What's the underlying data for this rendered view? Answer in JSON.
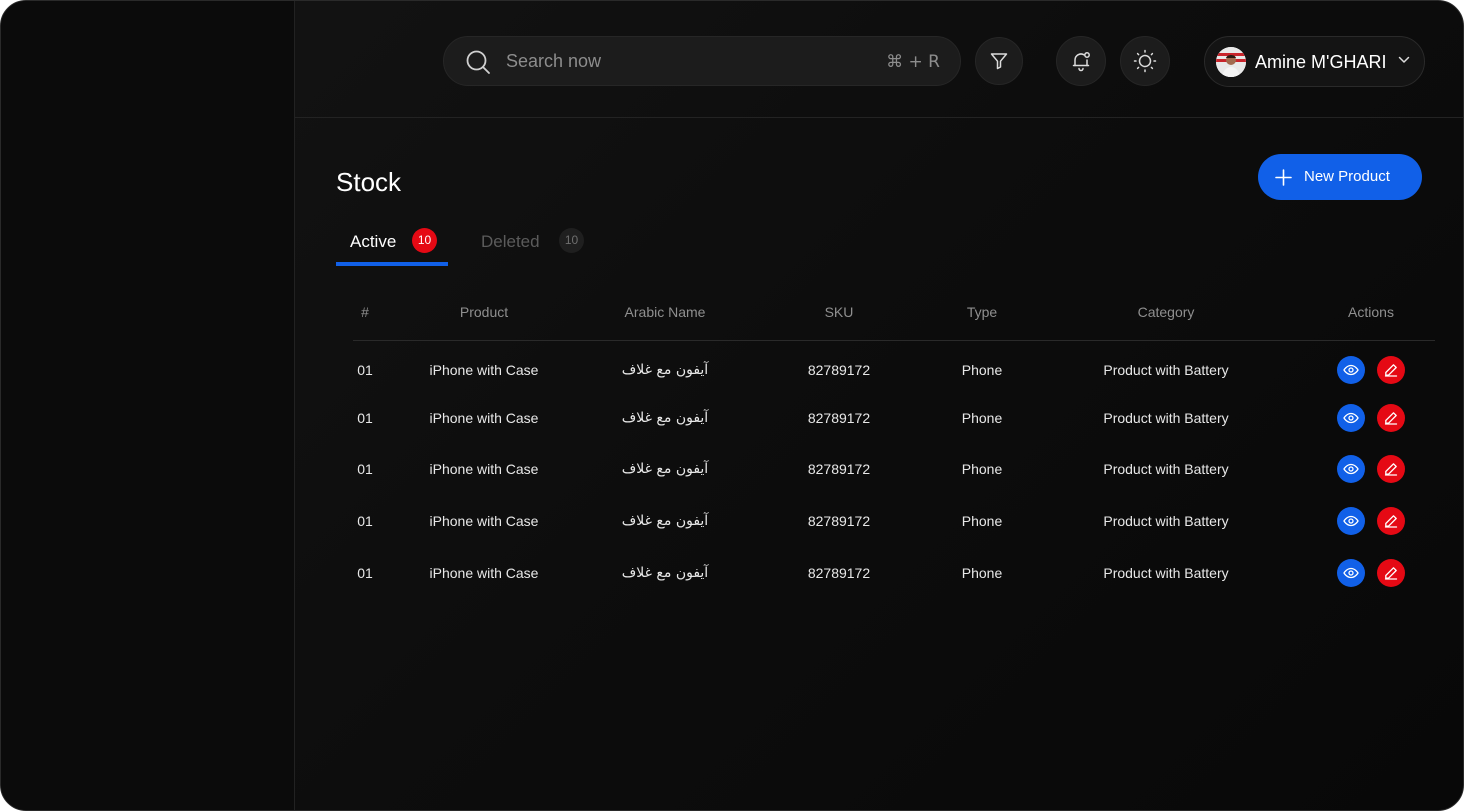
{
  "header": {
    "search": {
      "placeholder": "Search now",
      "shortcut": "⌘ + R"
    },
    "user": {
      "name": "Amine M'GHARI"
    }
  },
  "page": {
    "title": "Stock",
    "new_button_label": "New Product",
    "tabs": [
      {
        "label": "Active",
        "count": "10"
      },
      {
        "label": "Deleted",
        "count": "10"
      }
    ]
  },
  "table": {
    "columns": [
      "#",
      "Product",
      "Arabic Name",
      "SKU",
      "Type",
      "Category",
      "Actions"
    ],
    "rows": [
      {
        "num": "01",
        "product": "iPhone with Case",
        "arabic": "آيفون مع غلاف",
        "sku": "82789172",
        "type": "Phone",
        "category": "Product with Battery"
      },
      {
        "num": "01",
        "product": "iPhone with Case",
        "arabic": "آيفون مع غلاف",
        "sku": "82789172",
        "type": "Phone",
        "category": "Product with Battery"
      },
      {
        "num": "01",
        "product": "iPhone with Case",
        "arabic": "آيفون مع غلاف",
        "sku": "82789172",
        "type": "Phone",
        "category": "Product with Battery"
      },
      {
        "num": "01",
        "product": "iPhone with Case",
        "arabic": "آيفون مع غلاف",
        "sku": "82789172",
        "type": "Phone",
        "category": "Product with Battery"
      },
      {
        "num": "01",
        "product": "iPhone with Case",
        "arabic": "آيفون مع غلاف",
        "sku": "82789172",
        "type": "Phone",
        "category": "Product with Battery"
      }
    ]
  },
  "colors": {
    "accent": "#1160e8",
    "danger": "#e50914",
    "background": "#0d0d0d"
  },
  "icons": [
    "search-icon",
    "filter-icon",
    "bell-icon",
    "sun-icon",
    "chevron-down-icon",
    "plus-icon",
    "eye-icon",
    "edit-icon"
  ]
}
